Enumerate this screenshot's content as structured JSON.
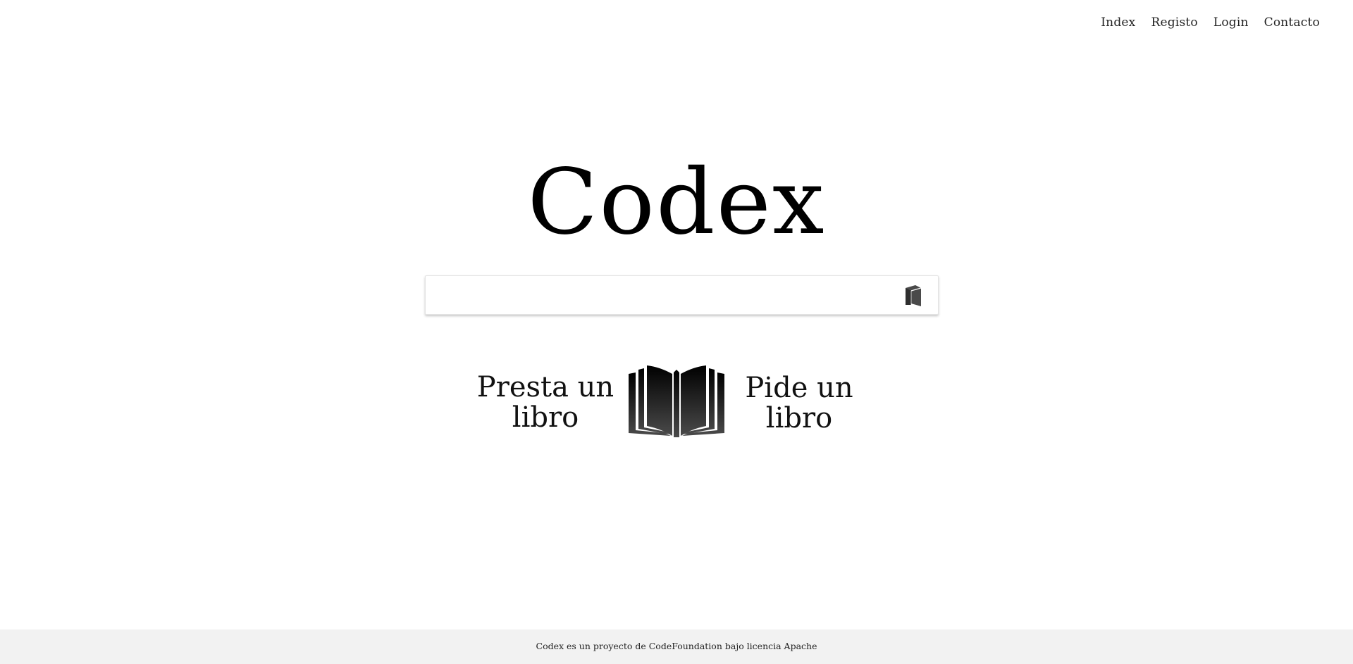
{
  "nav": {
    "items": [
      {
        "label": "Index"
      },
      {
        "label": "Registo"
      },
      {
        "label": "Login"
      },
      {
        "label": "Contacto"
      }
    ]
  },
  "brand": {
    "title": "Codex"
  },
  "search": {
    "value": "",
    "placeholder": "",
    "button_icon": "book-icon"
  },
  "actions": {
    "lend_line1": "Presta un",
    "lend_line2": "libro",
    "request_line1": "Pide un",
    "request_line2": "libro",
    "center_icon": "open-book-icon"
  },
  "footer": {
    "text": "Codex es un proyecto de CodeFoundation bajo licencia Apache"
  },
  "colors": {
    "text": "#1a1a1a",
    "footer_bg": "#f2f2f2",
    "icon": "#3a3a3a"
  }
}
